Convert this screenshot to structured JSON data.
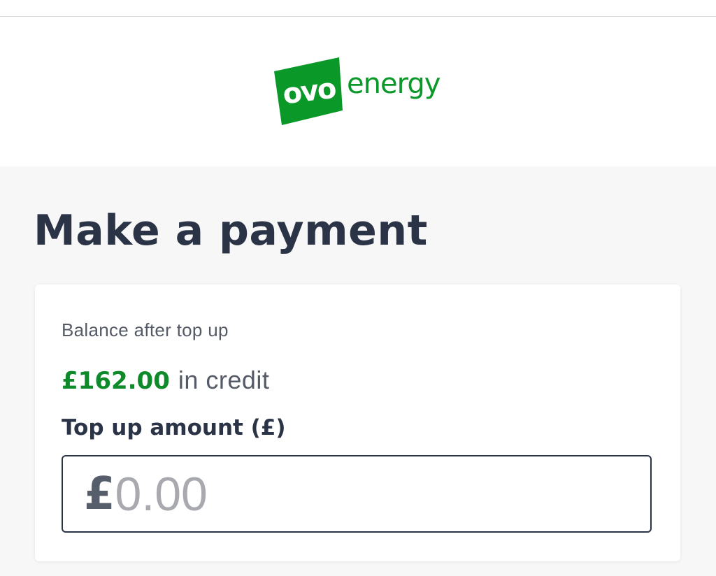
{
  "brand": {
    "logo_text": "ovo",
    "wordmark": "energy",
    "color": "#0a9828"
  },
  "page": {
    "title": "Make a payment"
  },
  "balance": {
    "label": "Balance after top up",
    "amount": "£162.00",
    "status": "in credit",
    "amount_color": "#0e8a2a"
  },
  "topup": {
    "label": "Top up amount (£)",
    "currency_symbol": "£",
    "placeholder": "0.00",
    "value": ""
  },
  "colors": {
    "heading": "#2b3446",
    "page_background": "#f7f7f7",
    "card_background": "#ffffff"
  }
}
